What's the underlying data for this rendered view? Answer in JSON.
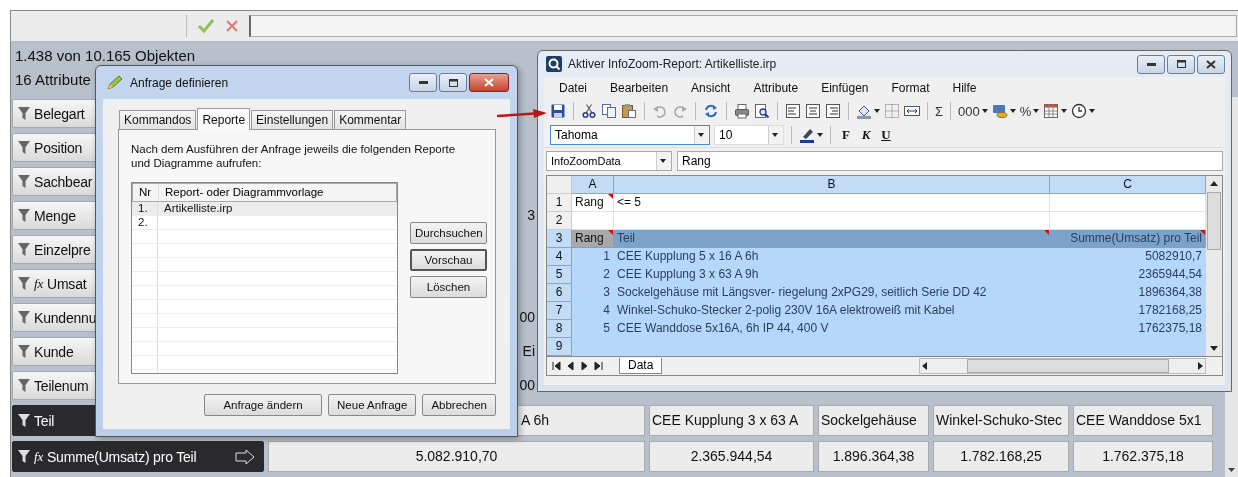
{
  "main_window": {
    "object_count": "1.438 von 10.165 Objekten",
    "attribute_count": "16 Attribute",
    "attributes": [
      {
        "label": "Belegart",
        "selected": false
      },
      {
        "label": "Position",
        "selected": false
      },
      {
        "label": "Sachbear",
        "selected": false
      },
      {
        "label": "Menge",
        "selected": false,
        "cells": [
          "3"
        ]
      },
      {
        "label": "Einzelpre",
        "selected": false
      },
      {
        "label": "Umsat",
        "prefix": "fx",
        "selected": false
      },
      {
        "label": "Kundennu",
        "selected": false,
        "cells": [
          "00"
        ]
      },
      {
        "label": "Kunde",
        "selected": false,
        "cells": [
          "Ei"
        ]
      },
      {
        "label": "Teilenum",
        "selected": false,
        "cells": [
          "00"
        ]
      },
      {
        "label": "Teil",
        "selected": true,
        "sorted": false,
        "kind": "text",
        "cells": [
          "A 6h",
          "CEE Kupplung 3 x 63 A",
          "Sockelgehäuse",
          "Winkel-Schuko-Stec",
          "CEE Wanddose 5x1"
        ]
      },
      {
        "label": "Summe(Umsatz) pro Teil",
        "prefix": "fx",
        "selected": true,
        "sorted": true,
        "kind": "number",
        "cells": [
          "5.082.910,70",
          "2.365.944,54",
          "1.896.364,38",
          "1.782.168,25",
          "1.762.375,18"
        ]
      }
    ]
  },
  "query_dialog": {
    "title": "Anfrage definieren",
    "tabs": [
      {
        "label": "Kommandos",
        "selected": false
      },
      {
        "label": "Reporte",
        "selected": true
      },
      {
        "label": "Einstellungen",
        "selected": false
      },
      {
        "label": "Kommentar",
        "selected": false
      }
    ],
    "description": "Nach dem Ausführen der Anfrage jeweils die folgenden Reporte und Diagramme aufrufen:",
    "list": {
      "columns": [
        "Nr",
        "Report- oder Diagrammvorlage"
      ],
      "rows": [
        {
          "nr": "1.",
          "template": "Artikelliste.irp",
          "selected": true
        },
        {
          "nr": "2.",
          "selected": false
        }
      ]
    },
    "side_buttons": [
      "Durchsuchen",
      "Vorschau",
      "Löschen"
    ],
    "buttons": [
      "Anfrage ändern",
      "Neue Anfrage",
      "Abbrechen"
    ]
  },
  "report_window": {
    "title": "Aktiver InfoZoom-Report: Artikelliste.irp",
    "menu": [
      "Datei",
      "Bearbeiten",
      "Ansicht",
      "Attribute",
      "Einfügen",
      "Format",
      "Hilfe"
    ],
    "toolbar_texts": {
      "sum": "Σ",
      "number_format": "000",
      "percent": "%"
    },
    "font": "Tahoma",
    "font_size": "10",
    "format_buttons": [
      "F",
      "K",
      "U"
    ],
    "name_box": "InfoZoomData",
    "formula": "Rang",
    "sheet": {
      "columns": [
        {
          "label": "A",
          "selected": true
        },
        {
          "label": "B",
          "selected": true
        },
        {
          "label": "C",
          "selected": true
        }
      ],
      "rows": [
        {
          "number": "1",
          "kind": "plain",
          "selected": false,
          "cells": [
            {
              "text": "Rang",
              "note": true
            },
            {
              "text": "<= 5",
              "note": false
            }
          ]
        },
        {
          "number": "2",
          "kind": "plain",
          "selected": false
        },
        {
          "number": "3",
          "kind": "header",
          "selected": true,
          "cells": [
            {
              "text": "Rang",
              "note": true
            },
            {
              "text": "Teil",
              "note": true
            },
            {
              "text": "Summe(Umsatz) pro Teil",
              "note": true
            }
          ]
        },
        {
          "number": "4",
          "kind": "data",
          "selected": true,
          "cells": [
            {
              "text": "1",
              "note": false
            },
            {
              "text": "CEE Kupplung 5 x 16 A 6h",
              "note": false
            },
            {
              "text": "5082910,7",
              "note": false
            }
          ]
        },
        {
          "number": "5",
          "kind": "data",
          "selected": true,
          "cells": [
            {
              "text": "2",
              "note": false
            },
            {
              "text": "CEE Kupplung 3 x 63 A 9h",
              "note": false
            },
            {
              "text": "2365944,54",
              "note": false
            }
          ]
        },
        {
          "number": "6",
          "kind": "data",
          "selected": true,
          "cells": [
            {
              "text": "3",
              "note": false
            },
            {
              "text": "Sockelgehäuse mit Längsver- riegelung 2xPG29, seitlich Serie DD 42",
              "note": false
            },
            {
              "text": "1896364,38",
              "note": false
            }
          ]
        },
        {
          "number": "7",
          "kind": "data",
          "selected": true,
          "cells": [
            {
              "text": "4",
              "note": false
            },
            {
              "text": "Winkel-Schuko-Stecker 2-polig 230V 16A elektroweiß mit Kabel",
              "note": false
            },
            {
              "text": "1782168,25",
              "note": false
            }
          ]
        },
        {
          "number": "8",
          "kind": "data",
          "selected": true,
          "cells": [
            {
              "text": "5",
              "note": false
            },
            {
              "text": "CEE Wanddose 5x16A, 6h IP 44, 400 V",
              "note": false
            },
            {
              "text": "1762375,18",
              "note": false
            }
          ]
        },
        {
          "number": "9",
          "kind": "data",
          "selected": true
        }
      ],
      "tabs": [
        {
          "label": "Data",
          "selected": true
        }
      ]
    }
  }
}
